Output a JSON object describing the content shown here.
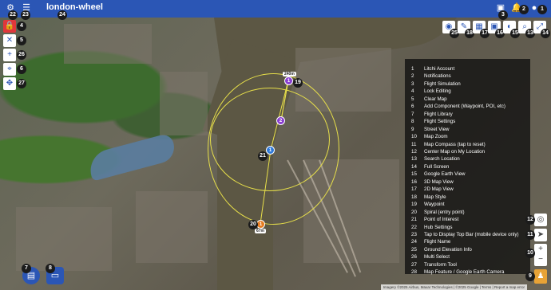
{
  "app": {
    "title": "london-wheel"
  },
  "colors": {
    "topbar": "#2b56b5",
    "legend_bg": "#111111",
    "circle": "#e8e04a",
    "waypoint": "#8a3fd1",
    "poi": "#2e78d8",
    "spiral": "#e77b1f",
    "lock": "#e0373b"
  },
  "top_badges": {
    "b22": "22",
    "b23": "23",
    "b24": "24",
    "b3": "3",
    "b2": "2",
    "b1": "1"
  },
  "right_toolbar": {
    "items": [
      {
        "icon": "eye-icon",
        "glyph": "◉",
        "badge": "25"
      },
      {
        "icon": "edit-icon",
        "glyph": "✎",
        "badge": "18"
      },
      {
        "icon": "map-2d-icon",
        "glyph": "▦",
        "badge": "17"
      },
      {
        "icon": "map-3d-icon",
        "glyph": "▣",
        "badge": "16"
      },
      {
        "icon": "globe-icon",
        "glyph": "◐",
        "badge": "15"
      },
      {
        "icon": "search-icon",
        "glyph": "⌕",
        "badge": "13"
      },
      {
        "icon": "fullscreen-icon",
        "glyph": "⤢",
        "badge": "14"
      }
    ]
  },
  "left_toolbar": {
    "items": [
      {
        "icon": "lock-icon",
        "glyph": "🔒",
        "badge": "4"
      },
      {
        "icon": "close-icon",
        "glyph": "✕",
        "badge": "5"
      },
      {
        "icon": "add-component-icon",
        "glyph": "+",
        "badge": "26"
      },
      {
        "icon": "location-icon",
        "glyph": "⌖",
        "badge": "6"
      },
      {
        "icon": "move-icon",
        "glyph": "✥",
        "badge": "27"
      }
    ]
  },
  "legend": {
    "items": [
      {
        "num": "1",
        "label": "Litchi Account"
      },
      {
        "num": "2",
        "label": "Notifications"
      },
      {
        "num": "3",
        "label": "Flight Simulation"
      },
      {
        "num": "4",
        "label": "Lock Editing"
      },
      {
        "num": "5",
        "label": "Clear Map"
      },
      {
        "num": "6",
        "label": "Add Component (Waypoint, POI, etc)"
      },
      {
        "num": "7",
        "label": "Flight Library"
      },
      {
        "num": "8",
        "label": "Flight Settings"
      },
      {
        "num": "9",
        "label": "Street View"
      },
      {
        "num": "10",
        "label": "Map Zoom"
      },
      {
        "num": "11",
        "label": "Map Compass (tap to reset)"
      },
      {
        "num": "12",
        "label": "Center Map on My Location"
      },
      {
        "num": "13",
        "label": "Search Location"
      },
      {
        "num": "14",
        "label": "Full Screen"
      },
      {
        "num": "15",
        "label": "Google Earth View"
      },
      {
        "num": "16",
        "label": "3D Map View"
      },
      {
        "num": "17",
        "label": "2D Map View"
      },
      {
        "num": "18",
        "label": "Map Style"
      },
      {
        "num": "19",
        "label": "Waypoint"
      },
      {
        "num": "20",
        "label": "Spiral (entry point)"
      },
      {
        "num": "21",
        "label": "Point of Interest"
      },
      {
        "num": "22",
        "label": "Hub Settings"
      },
      {
        "num": "23",
        "label": "Tap to Display Top Bar (mobile device only)"
      },
      {
        "num": "24",
        "label": "Flight Name"
      },
      {
        "num": "25",
        "label": "Ground Elevation Info"
      },
      {
        "num": "26",
        "label": "Multi Select"
      },
      {
        "num": "27",
        "label": "Transform Tool"
      },
      {
        "num": "28",
        "label": "Map Feature / Google Earth Camera"
      }
    ]
  },
  "waypoints": {
    "wp1": {
      "num": "1",
      "tag": "240m",
      "badge": "19"
    },
    "wp2": {
      "num": "2"
    },
    "poi": {
      "num": "1",
      "badge": "21"
    },
    "spiral": {
      "num": "1",
      "tag": "67m",
      "badge": "20"
    }
  },
  "bottom": {
    "library_badge": "7",
    "settings_badge": "8",
    "zoom_in": "+",
    "zoom_out": "−",
    "zoom_badge": "10",
    "compass_badge": "11",
    "locate_badge": "12",
    "streetview_badge": "9",
    "attribution": "Imagery ©2025 Airbus, Maxar Technologies | ©2025 Google | Terms | Report a map error"
  }
}
